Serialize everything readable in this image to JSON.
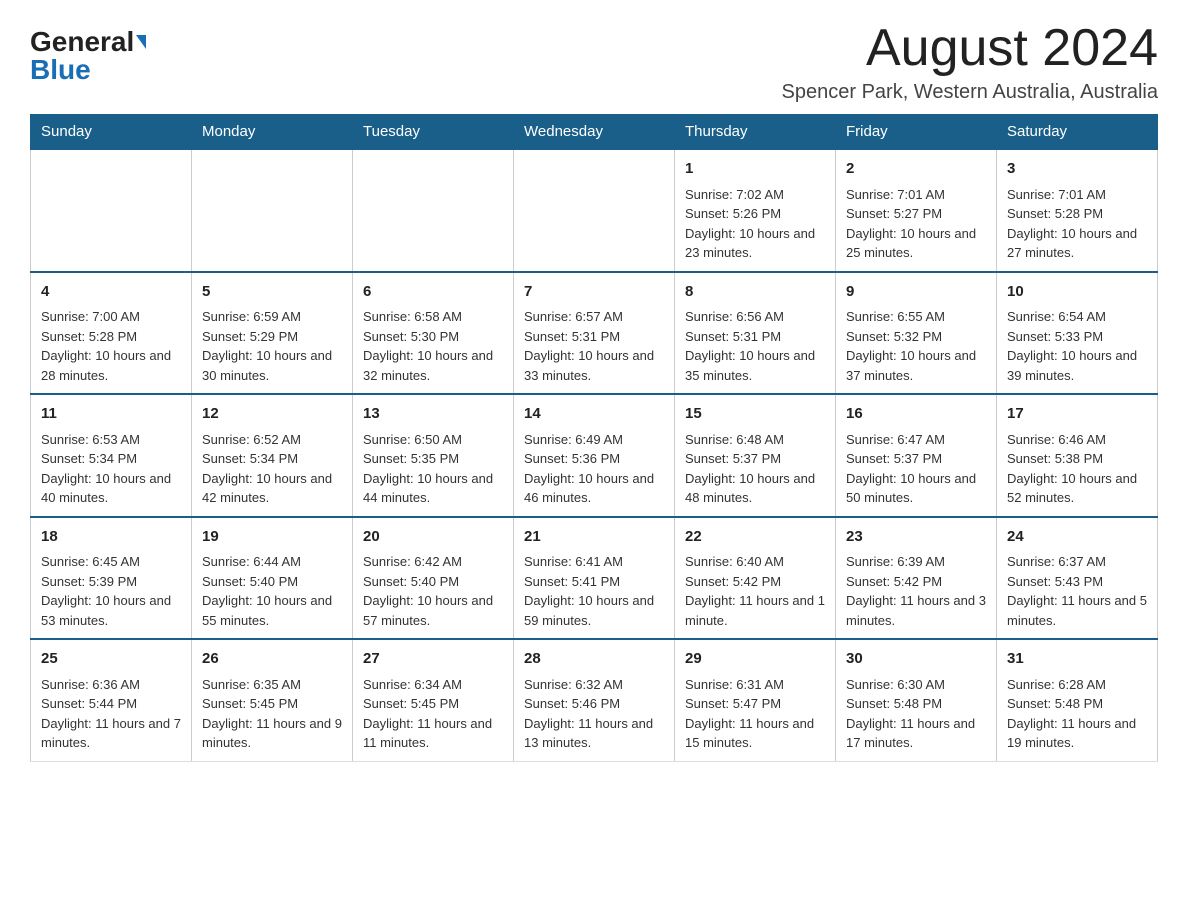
{
  "header": {
    "logo_general": "General",
    "logo_blue": "Blue",
    "title": "August 2024",
    "subtitle": "Spencer Park, Western Australia, Australia"
  },
  "weekdays": [
    "Sunday",
    "Monday",
    "Tuesday",
    "Wednesday",
    "Thursday",
    "Friday",
    "Saturday"
  ],
  "weeks": [
    [
      {
        "day": "",
        "info": ""
      },
      {
        "day": "",
        "info": ""
      },
      {
        "day": "",
        "info": ""
      },
      {
        "day": "",
        "info": ""
      },
      {
        "day": "1",
        "info": "Sunrise: 7:02 AM\nSunset: 5:26 PM\nDaylight: 10 hours and 23 minutes."
      },
      {
        "day": "2",
        "info": "Sunrise: 7:01 AM\nSunset: 5:27 PM\nDaylight: 10 hours and 25 minutes."
      },
      {
        "day": "3",
        "info": "Sunrise: 7:01 AM\nSunset: 5:28 PM\nDaylight: 10 hours and 27 minutes."
      }
    ],
    [
      {
        "day": "4",
        "info": "Sunrise: 7:00 AM\nSunset: 5:28 PM\nDaylight: 10 hours and 28 minutes."
      },
      {
        "day": "5",
        "info": "Sunrise: 6:59 AM\nSunset: 5:29 PM\nDaylight: 10 hours and 30 minutes."
      },
      {
        "day": "6",
        "info": "Sunrise: 6:58 AM\nSunset: 5:30 PM\nDaylight: 10 hours and 32 minutes."
      },
      {
        "day": "7",
        "info": "Sunrise: 6:57 AM\nSunset: 5:31 PM\nDaylight: 10 hours and 33 minutes."
      },
      {
        "day": "8",
        "info": "Sunrise: 6:56 AM\nSunset: 5:31 PM\nDaylight: 10 hours and 35 minutes."
      },
      {
        "day": "9",
        "info": "Sunrise: 6:55 AM\nSunset: 5:32 PM\nDaylight: 10 hours and 37 minutes."
      },
      {
        "day": "10",
        "info": "Sunrise: 6:54 AM\nSunset: 5:33 PM\nDaylight: 10 hours and 39 minutes."
      }
    ],
    [
      {
        "day": "11",
        "info": "Sunrise: 6:53 AM\nSunset: 5:34 PM\nDaylight: 10 hours and 40 minutes."
      },
      {
        "day": "12",
        "info": "Sunrise: 6:52 AM\nSunset: 5:34 PM\nDaylight: 10 hours and 42 minutes."
      },
      {
        "day": "13",
        "info": "Sunrise: 6:50 AM\nSunset: 5:35 PM\nDaylight: 10 hours and 44 minutes."
      },
      {
        "day": "14",
        "info": "Sunrise: 6:49 AM\nSunset: 5:36 PM\nDaylight: 10 hours and 46 minutes."
      },
      {
        "day": "15",
        "info": "Sunrise: 6:48 AM\nSunset: 5:37 PM\nDaylight: 10 hours and 48 minutes."
      },
      {
        "day": "16",
        "info": "Sunrise: 6:47 AM\nSunset: 5:37 PM\nDaylight: 10 hours and 50 minutes."
      },
      {
        "day": "17",
        "info": "Sunrise: 6:46 AM\nSunset: 5:38 PM\nDaylight: 10 hours and 52 minutes."
      }
    ],
    [
      {
        "day": "18",
        "info": "Sunrise: 6:45 AM\nSunset: 5:39 PM\nDaylight: 10 hours and 53 minutes."
      },
      {
        "day": "19",
        "info": "Sunrise: 6:44 AM\nSunset: 5:40 PM\nDaylight: 10 hours and 55 minutes."
      },
      {
        "day": "20",
        "info": "Sunrise: 6:42 AM\nSunset: 5:40 PM\nDaylight: 10 hours and 57 minutes."
      },
      {
        "day": "21",
        "info": "Sunrise: 6:41 AM\nSunset: 5:41 PM\nDaylight: 10 hours and 59 minutes."
      },
      {
        "day": "22",
        "info": "Sunrise: 6:40 AM\nSunset: 5:42 PM\nDaylight: 11 hours and 1 minute."
      },
      {
        "day": "23",
        "info": "Sunrise: 6:39 AM\nSunset: 5:42 PM\nDaylight: 11 hours and 3 minutes."
      },
      {
        "day": "24",
        "info": "Sunrise: 6:37 AM\nSunset: 5:43 PM\nDaylight: 11 hours and 5 minutes."
      }
    ],
    [
      {
        "day": "25",
        "info": "Sunrise: 6:36 AM\nSunset: 5:44 PM\nDaylight: 11 hours and 7 minutes."
      },
      {
        "day": "26",
        "info": "Sunrise: 6:35 AM\nSunset: 5:45 PM\nDaylight: 11 hours and 9 minutes."
      },
      {
        "day": "27",
        "info": "Sunrise: 6:34 AM\nSunset: 5:45 PM\nDaylight: 11 hours and 11 minutes."
      },
      {
        "day": "28",
        "info": "Sunrise: 6:32 AM\nSunset: 5:46 PM\nDaylight: 11 hours and 13 minutes."
      },
      {
        "day": "29",
        "info": "Sunrise: 6:31 AM\nSunset: 5:47 PM\nDaylight: 11 hours and 15 minutes."
      },
      {
        "day": "30",
        "info": "Sunrise: 6:30 AM\nSunset: 5:48 PM\nDaylight: 11 hours and 17 minutes."
      },
      {
        "day": "31",
        "info": "Sunrise: 6:28 AM\nSunset: 5:48 PM\nDaylight: 11 hours and 19 minutes."
      }
    ]
  ]
}
